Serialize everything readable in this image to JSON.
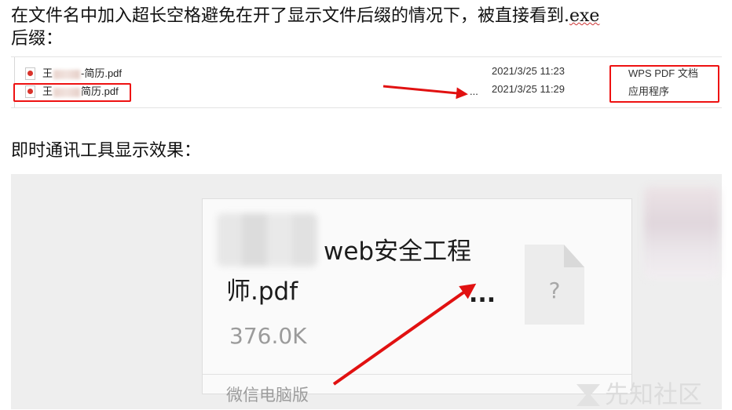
{
  "intro": {
    "line1": "在文件名中加入超长空格避免在开了显示文件后缀的情况下，被直接看到.",
    "ext": "exe",
    "line2": "后缀："
  },
  "explorer": {
    "rows": [
      {
        "name_prefix": "王",
        "name_suffix": "-简历.pdf",
        "date": "2021/3/25 11:23",
        "type": "WPS PDF 文档"
      },
      {
        "name_prefix": "王",
        "name_suffix": "简历.pdf",
        "date": "2021/3/25 11:29",
        "type": "应用程序"
      }
    ],
    "ellipsis": "..."
  },
  "section2_title": "即时通讯工具显示效果：",
  "chat_card": {
    "name_line1": "web安全工程",
    "name_line2": "师.pdf",
    "ellipsis": "...",
    "size": "376.0K",
    "source": "微信电脑版",
    "file_icon_glyph": "?"
  },
  "watermark": "先知社区",
  "colors": {
    "highlight_red": "#e11111"
  }
}
